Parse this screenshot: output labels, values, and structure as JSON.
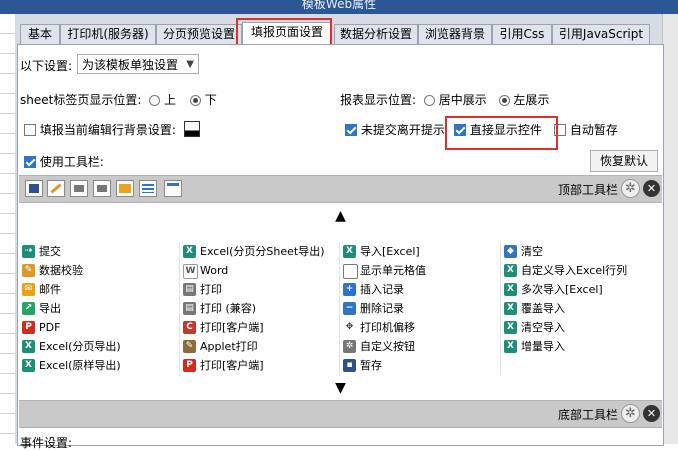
{
  "window": {
    "title": "模板Web属性"
  },
  "tabs": [
    {
      "label": "基本",
      "active": false
    },
    {
      "label": "打印机(服务器)",
      "active": false
    },
    {
      "label": "分页预览设置",
      "active": false
    },
    {
      "label": "填报页面设置",
      "active": true
    },
    {
      "label": "数据分析设置",
      "active": false
    },
    {
      "label": "浏览器背景",
      "active": false
    },
    {
      "label": "引用Css",
      "active": false
    },
    {
      "label": "引用JavaScript",
      "active": false
    }
  ],
  "settings": {
    "scope_label": "以下设置:",
    "scope_value": "为该模板单独设置",
    "sheet_tab_label": "sheet标签页显示位置:",
    "sheet_tab_options": [
      "上",
      "下"
    ],
    "sheet_tab_selected": "下",
    "report_pos_label": "报表显示位置:",
    "report_pos_options": [
      "居中展示",
      "左展示"
    ],
    "report_pos_selected": "左展示",
    "fill_bg_label": "填报当前编辑行背景设置:",
    "fill_bg_checked": false,
    "unsaved_prompt_label": "未提交离开提示",
    "unsaved_prompt_checked": true,
    "direct_display_label": "直接显示控件",
    "direct_display_checked": true,
    "autosave_label": "自动暂存",
    "autosave_checked": false,
    "use_toolbar_label": "使用工具栏:",
    "use_toolbar_checked": true,
    "restore_default_label": "恢复默认"
  },
  "toolbar_designer": {
    "top_label": "顶部工具栏",
    "bottom_label": "底部工具栏",
    "top_icons": [
      "save-icon",
      "pencil-icon",
      "print-icon",
      "print-icon",
      "email-icon",
      "list-icon",
      "window-icon"
    ]
  },
  "buttons": [
    [
      {
        "label": "提交",
        "icon": "submit-icon",
        "color": "#1d8f76"
      },
      {
        "label": "数据校验",
        "icon": "pencil-icon",
        "color": "#d89a2a"
      },
      {
        "label": "邮件",
        "icon": "email-icon",
        "color": "#e8a21c"
      },
      {
        "label": "导出",
        "icon": "export-icon",
        "color": "#2aa36b"
      },
      {
        "label": "PDF",
        "icon": "pdf-icon",
        "color": "#d52b1e"
      },
      {
        "label": "Excel(分页导出)",
        "icon": "excel-icon",
        "color": "#1d8f76"
      },
      {
        "label": "Excel(原样导出)",
        "icon": "excel-icon",
        "color": "#1d8f76"
      }
    ],
    [
      {
        "label": "Excel(分页分Sheet导出)",
        "icon": "excel-icon",
        "color": "#1d8f76"
      },
      {
        "label": "Word",
        "icon": "word-icon",
        "color": "#666666"
      },
      {
        "label": "打印",
        "icon": "print-icon",
        "color": "#777777"
      },
      {
        "label": "打印 (兼容)",
        "icon": "print-icon",
        "color": "#777777"
      },
      {
        "label": "打印[客户端]",
        "icon": "print-client-icon",
        "color": "#c0392b"
      },
      {
        "label": "Applet打印",
        "icon": "applet-icon",
        "color": "#8a6d3b"
      },
      {
        "label": "打印[客户端]",
        "icon": "pdf-print-icon",
        "color": "#d52b1e"
      }
    ],
    [
      {
        "label": "导入[Excel]",
        "icon": "import-excel-icon",
        "color": "#1d8f76"
      },
      {
        "label": "显示单元格值",
        "icon": "cell-value-icon",
        "color": "#555555"
      },
      {
        "label": "插入记录",
        "icon": "insert-record-icon",
        "color": "#2f74c9"
      },
      {
        "label": "删除记录",
        "icon": "delete-record-icon",
        "color": "#2f74c9"
      },
      {
        "label": "打印机偏移",
        "icon": "move-icon",
        "color": "#444444"
      },
      {
        "label": "自定义按钮",
        "icon": "gear-icon",
        "color": "#777777"
      },
      {
        "label": "暂存",
        "icon": "save-icon",
        "color": "#2f4f8f"
      }
    ],
    [
      {
        "label": "清空",
        "icon": "eraser-icon",
        "color": "#2f74c9"
      },
      {
        "label": "自定义导入Excel行列",
        "icon": "excel-icon",
        "color": "#1d8f76"
      },
      {
        "label": "多次导入[Excel]",
        "icon": "excel-icon",
        "color": "#1d8f76"
      },
      {
        "label": "覆盖导入",
        "icon": "excel-icon",
        "color": "#1d8f76"
      },
      {
        "label": "清空导入",
        "icon": "excel-icon",
        "color": "#1d8f76"
      },
      {
        "label": "增量导入",
        "icon": "excel-icon",
        "color": "#1d8f76"
      }
    ]
  ],
  "footer": {
    "event_label": "事件设置:"
  }
}
